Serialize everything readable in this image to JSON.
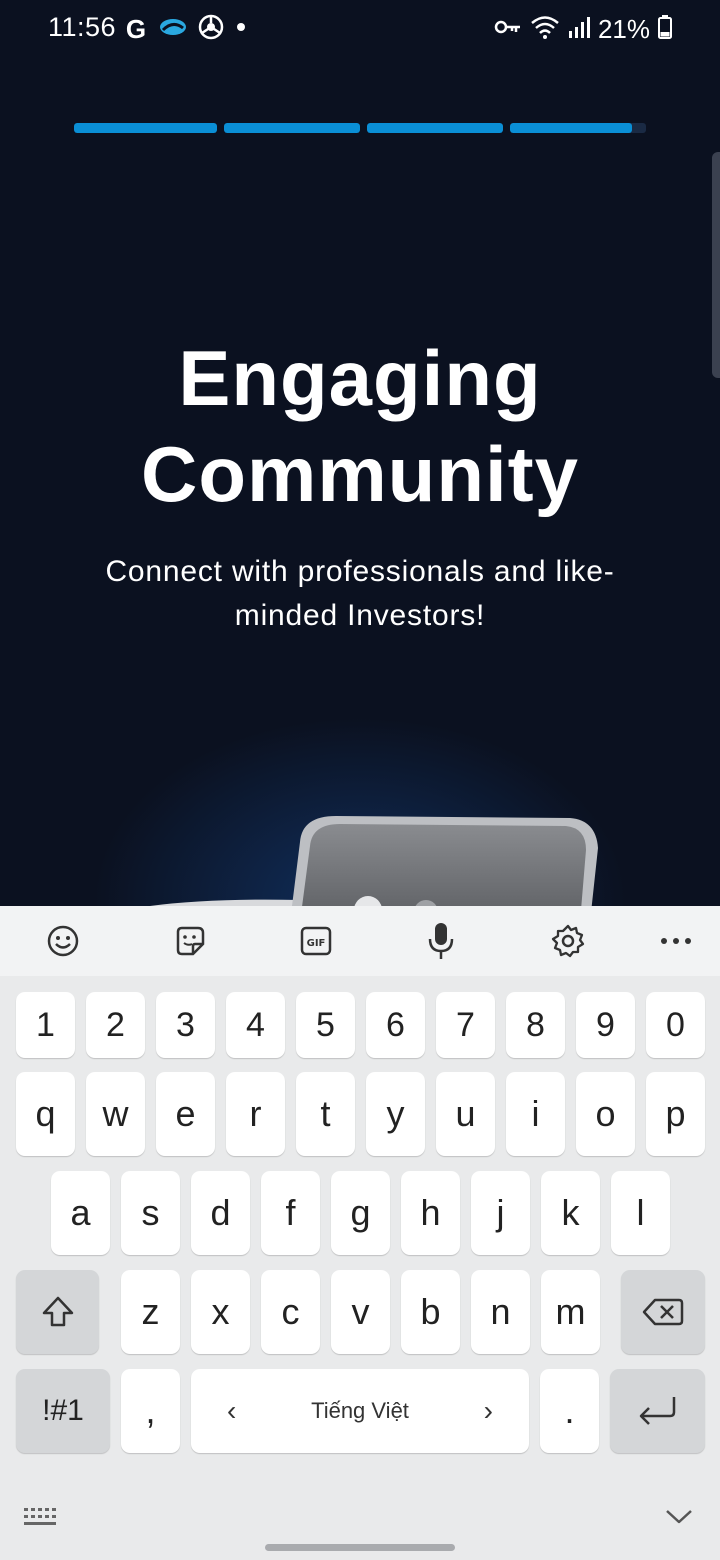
{
  "status_bar": {
    "time": "11:56",
    "battery": "21%",
    "icons": [
      "google-icon",
      "cloud-icon",
      "chrome-icon",
      "dot-icon",
      "key-icon",
      "wifi-icon",
      "signal-icon",
      "battery-icon"
    ]
  },
  "onboarding": {
    "progress_segments": [
      1.0,
      1.0,
      1.0,
      0.9
    ],
    "title_line1": "Engaging",
    "title_line2": "Community",
    "subtitle_line1": "Connect with professionals and like-",
    "subtitle_line2": "minded Investors!"
  },
  "keyboard": {
    "toolbar": [
      "emoji-icon",
      "sticker-icon",
      "gif-icon",
      "mic-icon",
      "settings-icon",
      "more-icon"
    ],
    "gif_label": "GIF",
    "row_numbers": [
      "1",
      "2",
      "3",
      "4",
      "5",
      "6",
      "7",
      "8",
      "9",
      "0"
    ],
    "row1": [
      "q",
      "w",
      "e",
      "r",
      "t",
      "y",
      "u",
      "i",
      "o",
      "p"
    ],
    "row2": [
      "a",
      "s",
      "d",
      "f",
      "g",
      "h",
      "j",
      "k",
      "l"
    ],
    "row3": [
      "z",
      "x",
      "c",
      "v",
      "b",
      "n",
      "m"
    ],
    "symbols_label": "!#1",
    "comma": ",",
    "space_label": "Tiếng Việt",
    "period": "."
  },
  "colors": {
    "background": "#0b1120",
    "accent": "#0a8fd6",
    "keyboard_bg": "#e9eaeb"
  }
}
